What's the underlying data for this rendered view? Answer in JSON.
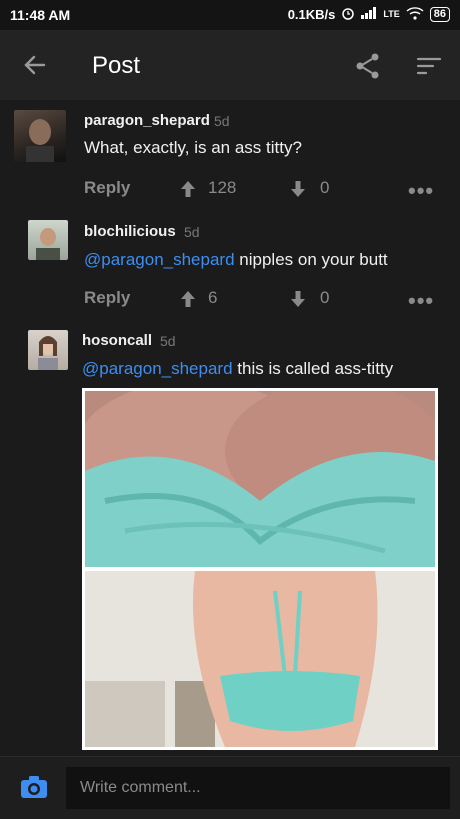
{
  "status": {
    "time": "11:48 AM",
    "net_speed": "0.1KB/s",
    "network": "LTE",
    "battery": "86"
  },
  "appbar": {
    "title": "Post",
    "back_icon": "arrow-left-icon",
    "share_icon": "share-icon",
    "sort_icon": "sort-icon"
  },
  "comments": [
    {
      "author": "paragon_shepard",
      "age": "5d",
      "body": "What, exactly, is an ass titty?",
      "mention": "",
      "reply_label": "Reply",
      "upvotes": "128",
      "downvotes": "0"
    },
    {
      "author": "blochilicious",
      "age": "5d",
      "mention": "@paragon_shepard",
      "body": " nipples on your butt",
      "reply_label": "Reply",
      "upvotes": "6",
      "downvotes": "0"
    },
    {
      "author": "hosoncall",
      "age": "5d",
      "mention": "@paragon_shepard",
      "body": " this is called ass-titty"
    }
  ],
  "composer": {
    "placeholder": "Write comment..."
  },
  "colors": {
    "background": "#1b1b1b",
    "appbar": "#232323",
    "accent": "#3d8ef0",
    "muted": "#8a8a8a"
  }
}
